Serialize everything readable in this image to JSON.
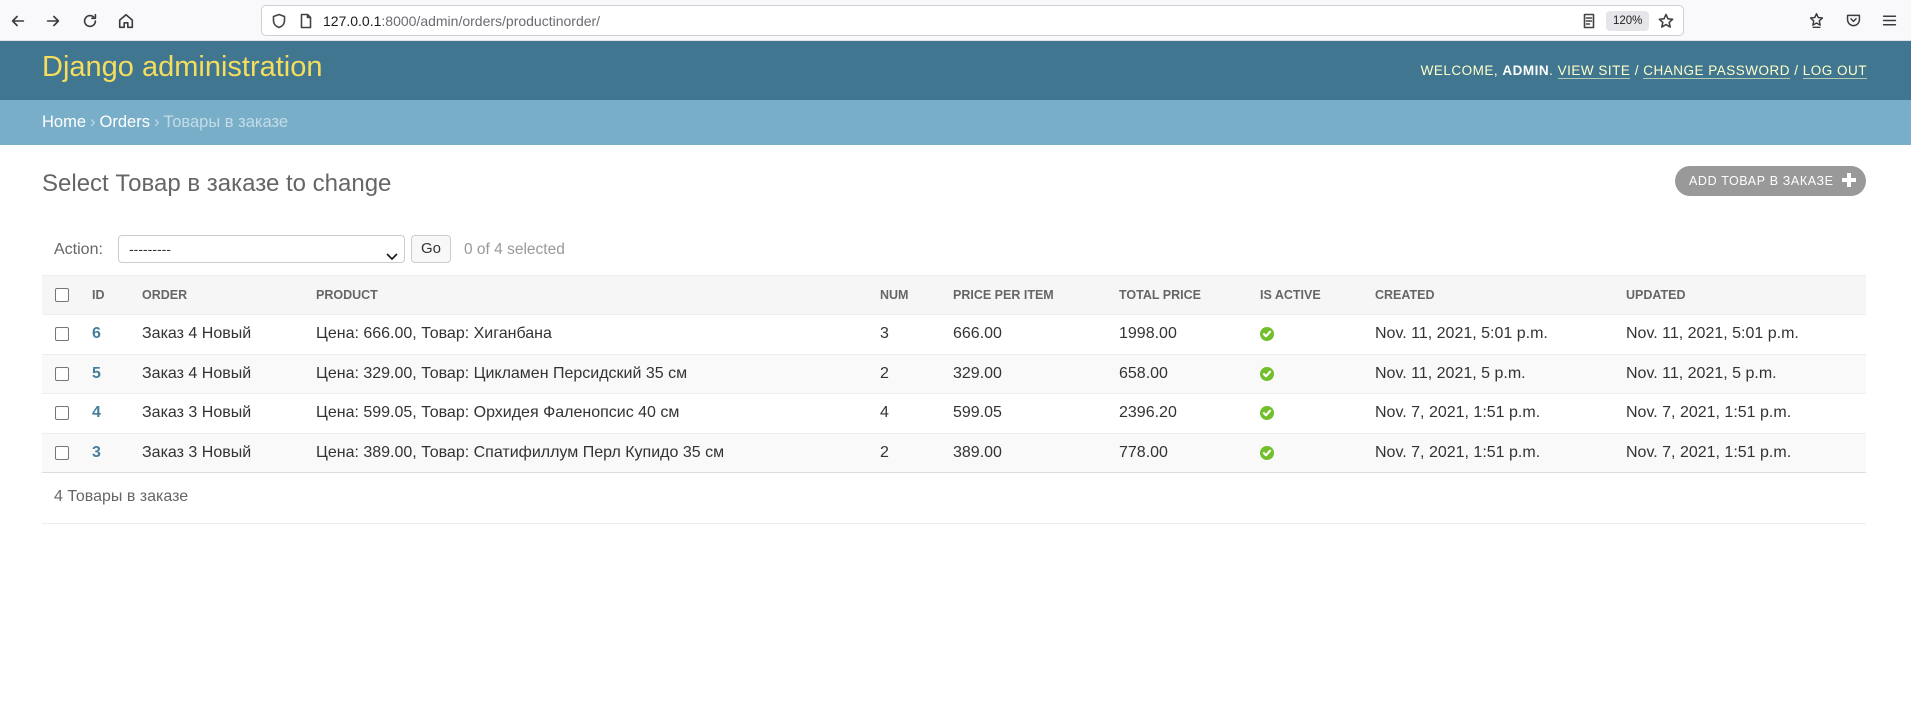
{
  "browser": {
    "url_host": "127.0.0.1",
    "url_rest": ":8000/admin/orders/productinorder/",
    "zoom": "120%"
  },
  "header": {
    "site_name": "Django administration",
    "welcome": "Welcome,",
    "user": "admin",
    "view_site": "View site",
    "change_password": "Change password",
    "log_out": "Log out"
  },
  "breadcrumbs": {
    "home": "Home",
    "app": "Orders",
    "current": "Товары в заказе"
  },
  "main": {
    "title": "Select Товар в заказе to change",
    "add_button": "Add Товар в заказе"
  },
  "actions": {
    "label": "Action:",
    "selected_option": "---------",
    "go": "Go",
    "counter": "0 of 4 selected"
  },
  "table": {
    "columns": [
      "ID",
      "Order",
      "Product",
      "Num",
      "Price per item",
      "Total price",
      "Is active",
      "Created",
      "Updated"
    ],
    "rows": [
      {
        "id": "6",
        "order": "Заказ 4 Новый",
        "product": "Цена: 666.00, Товар: Хиганбана",
        "num": "3",
        "price": "666.00",
        "total": "1998.00",
        "is_active": true,
        "created": "Nov. 11, 2021, 5:01 p.m.",
        "updated": "Nov. 11, 2021, 5:01 p.m."
      },
      {
        "id": "5",
        "order": "Заказ 4 Новый",
        "product": "Цена: 329.00, Товар: Цикламен Персидский 35 см",
        "num": "2",
        "price": "329.00",
        "total": "658.00",
        "is_active": true,
        "created": "Nov. 11, 2021, 5 p.m.",
        "updated": "Nov. 11, 2021, 5 p.m."
      },
      {
        "id": "4",
        "order": "Заказ 3 Новый",
        "product": "Цена: 599.05, Товар: Орхидея Фаленопсис 40 см",
        "num": "4",
        "price": "599.05",
        "total": "2396.20",
        "is_active": true,
        "created": "Nov. 7, 2021, 1:51 p.m.",
        "updated": "Nov. 7, 2021, 1:51 p.m."
      },
      {
        "id": "3",
        "order": "Заказ 3 Новый",
        "product": "Цена: 389.00, Товар: Спатифиллум Перл Купидо 35 см",
        "num": "2",
        "price": "389.00",
        "total": "778.00",
        "is_active": true,
        "created": "Nov. 7, 2021, 1:51 p.m.",
        "updated": "Nov. 7, 2021, 1:51 p.m."
      }
    ]
  },
  "paginator": {
    "text": "4 Товары в заказе"
  },
  "colors": {
    "header_bg": "#417690",
    "branding": "#f5dd5d",
    "breadcrumbs_bg": "#79aec8",
    "link": "#447e9b",
    "yes_icon": "#70bf2b"
  }
}
